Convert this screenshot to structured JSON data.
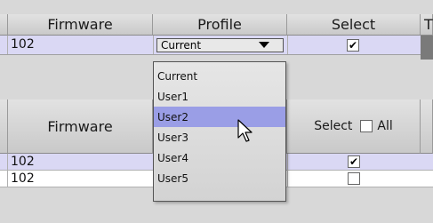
{
  "table1": {
    "headers": {
      "firmware": "Firmware",
      "profile": "Profile",
      "select": "Select",
      "overflow": "T"
    },
    "row": {
      "firmware": "102",
      "profile": "Current",
      "select_checked": true
    }
  },
  "dropdown": {
    "options": [
      "Current",
      "User1",
      "User2",
      "User3",
      "User4",
      "User5"
    ],
    "highlighted": "User2"
  },
  "table2": {
    "headers": {
      "firmware": "Firmware",
      "select": "Select",
      "all": "All"
    },
    "rows": [
      {
        "firmware": "102",
        "selected": true
      },
      {
        "firmware": "102",
        "selected": false
      }
    ]
  },
  "colors": {
    "selected_row": "#dad8f4",
    "highlight_item": "#9a9ee6",
    "menu_bg": "#dedede"
  }
}
